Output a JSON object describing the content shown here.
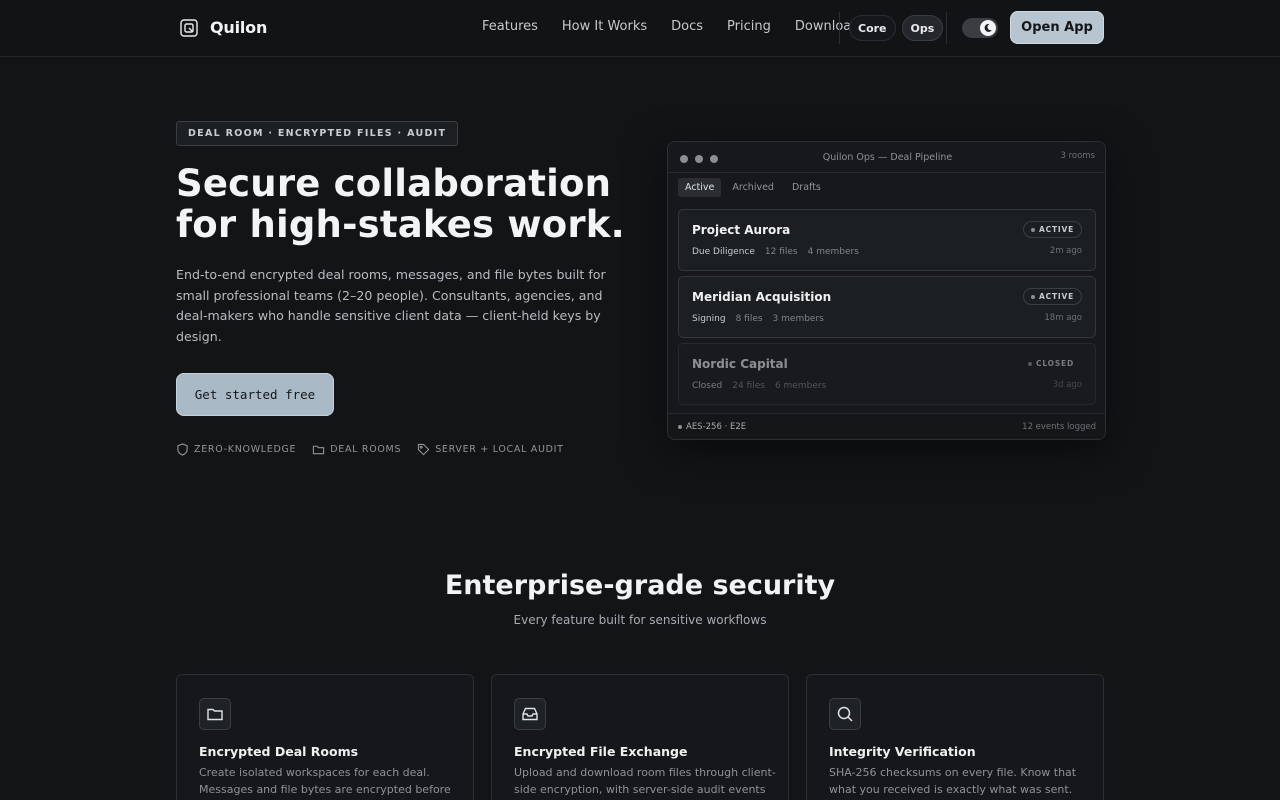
{
  "nav": {
    "brand": "Quilon",
    "links": [
      "Features",
      "How It Works",
      "Docs",
      "Pricing",
      "Download"
    ],
    "modes": [
      "Core",
      "Ops"
    ],
    "active_mode": "Ops",
    "open_app": "Open App"
  },
  "hero": {
    "badge": "DEAL ROOM · ENCRYPTED FILES · AUDIT",
    "title_line1": "Secure collaboration",
    "title_line2": "for high-stakes work.",
    "description": "End-to-end encrypted deal rooms, messages, and file bytes built for small professional teams (2–20 people). Consultants, agencies, and deal-makers who handle sensitive client data — client-held keys by design.",
    "cta": "Get started free",
    "features": [
      "ZERO-KNOWLEDGE",
      "DEAL ROOMS",
      "SERVER + LOCAL AUDIT"
    ]
  },
  "preview": {
    "title": "Quilon Ops — Deal Pipeline",
    "count": "3 rooms",
    "tabs": [
      "Active",
      "Archived",
      "Drafts"
    ],
    "rooms": [
      {
        "name": "Project Aurora",
        "stage": "Due Diligence",
        "files": "12 files",
        "members": "4 members",
        "status": "ACTIVE",
        "time": "2m ago"
      },
      {
        "name": "Meridian Acquisition",
        "stage": "Signing",
        "files": "8 files",
        "members": "3 members",
        "status": "ACTIVE",
        "time": "18m ago"
      },
      {
        "name": "Nordic Capital",
        "stage": "Closed",
        "files": "24 files",
        "members": "6 members",
        "status": "CLOSED",
        "time": "3d ago"
      }
    ],
    "encryption": "AES-256 · E2E",
    "events": "12 events logged"
  },
  "section": {
    "title": "Enterprise-grade security",
    "subtitle": "Every feature built for sensitive workflows",
    "cards": [
      {
        "icon": "folder-icon",
        "title": "Encrypted Deal Rooms",
        "desc": "Create isolated workspaces for each deal. Messages and file bytes are encrypted before"
      },
      {
        "icon": "inbox-icon",
        "title": "Encrypted File Exchange",
        "desc": "Upload and download room files through client-side encryption, with server-side audit events"
      },
      {
        "icon": "search-icon",
        "title": "Integrity Verification",
        "desc": "SHA-256 checksums on every file. Know that what you received is exactly what was sent."
      }
    ]
  },
  "colors": {
    "background": "#121416",
    "accent": "#b7c5d1",
    "cta": "#a9b9c6"
  }
}
